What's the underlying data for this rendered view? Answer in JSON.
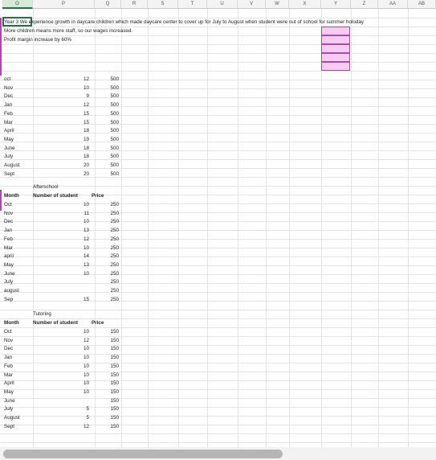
{
  "columns": [
    "O",
    "P",
    "Q",
    "R",
    "S",
    "T",
    "U",
    "V",
    "W",
    "X",
    "Y",
    "Z",
    "AA",
    "AB"
  ],
  "active_column": "O",
  "notes": [
    "Year 3  We experience growth in daycare children which made daycare center to cover up for July to August when student were out of school for summer holoday",
    "More children means more staff, so our wages increased.",
    "Profit margin increase by 60%"
  ],
  "sections": [
    {
      "title": "",
      "header": null,
      "rows": [
        [
          "oct",
          "12",
          "500"
        ],
        [
          "Nov",
          "10",
          "500"
        ],
        [
          "Dec",
          "9",
          "500"
        ],
        [
          "Jan",
          "12",
          "500"
        ],
        [
          "Feb",
          "15",
          "500"
        ],
        [
          "Mar",
          "15",
          "500"
        ],
        [
          "April",
          "18",
          "500"
        ],
        [
          "May",
          "19",
          "500"
        ],
        [
          "June",
          "18",
          "500"
        ],
        [
          "July",
          "18",
          "500"
        ],
        [
          "August",
          "20",
          "500"
        ],
        [
          "Sept",
          "20",
          "500"
        ]
      ]
    },
    {
      "title": "Afterschool",
      "header": [
        "Month",
        "Number of student",
        "Price"
      ],
      "rows": [
        [
          "Oct",
          "10",
          "250"
        ],
        [
          "Nov",
          "11",
          "250"
        ],
        [
          "Dec",
          "10",
          "250"
        ],
        [
          "Jan",
          "13",
          "250"
        ],
        [
          "Feb",
          "12",
          "250"
        ],
        [
          "Mar",
          "10",
          "250"
        ],
        [
          "april",
          "14",
          "250"
        ],
        [
          "May",
          "13",
          "250"
        ],
        [
          "June",
          "10",
          "250"
        ],
        [
          "July",
          "",
          "250"
        ],
        [
          "august",
          "",
          "250"
        ],
        [
          "Sep",
          "15",
          "250"
        ]
      ]
    },
    {
      "title": "Tutoring",
      "header": [
        "Month",
        "Number of student",
        "Price"
      ],
      "rows": [
        [
          "Oct",
          "10",
          "150"
        ],
        [
          "Nov",
          "12",
          "150"
        ],
        [
          "Dec",
          "10",
          "150"
        ],
        [
          "Jan",
          "10",
          "150"
        ],
        [
          "Feb",
          "10",
          "150"
        ],
        [
          "Mar",
          "10",
          "150"
        ],
        [
          "April",
          "10",
          "150"
        ],
        [
          "May",
          "10",
          "150"
        ],
        [
          "June",
          "",
          "150"
        ],
        [
          "July",
          "5",
          "150"
        ],
        [
          "August",
          "5",
          "150"
        ],
        [
          "Sept",
          "12",
          "150"
        ]
      ]
    }
  ],
  "colors": {
    "selection": "#217346",
    "pink_fill": "#f4cdf0",
    "pink_border": "#a64ca6"
  }
}
